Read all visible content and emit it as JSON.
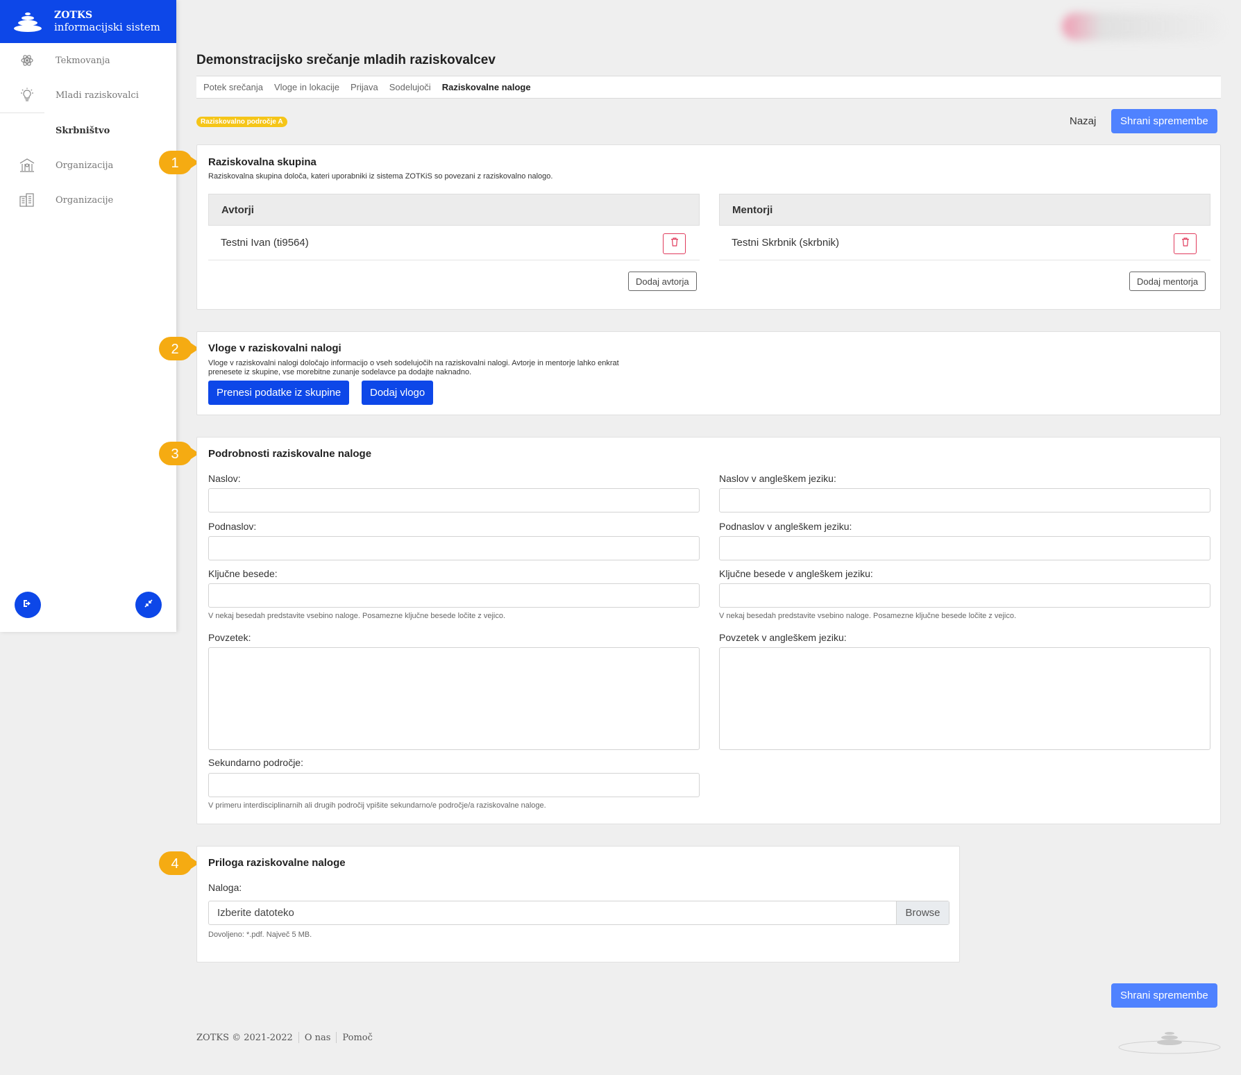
{
  "brand": {
    "line1": "ZOTKS",
    "line2": "informacijski sistem"
  },
  "sidebar": {
    "items": [
      {
        "label": "Tekmovanja",
        "icon": "atom-icon"
      },
      {
        "label": "Mladi raziskovalci",
        "icon": "lightbulb-icon"
      }
    ],
    "section": "Skrbništvo",
    "items2": [
      {
        "label": "Organizacija",
        "icon": "institution-icon"
      },
      {
        "label": "Organizacije",
        "icon": "buildings-icon"
      }
    ]
  },
  "page": {
    "title": "Demonstracijsko srečanje mladih raziskovalcev"
  },
  "tabs": [
    "Potek srečanja",
    "Vloge in lokacije",
    "Prijava",
    "Sodelujoči",
    "Raziskovalne naloge"
  ],
  "badge": "Raziskovalno področje A",
  "actions": {
    "back": "Nazaj",
    "save": "Shrani spremembe"
  },
  "markers": [
    "1",
    "2",
    "3",
    "4"
  ],
  "group": {
    "title": "Raziskovalna skupina",
    "desc": "Raziskovalna skupina določa, kateri uporabniki iz sistema ZOTKiS so povezani z raziskovalno nalogo.",
    "authors": {
      "header": "Avtorji",
      "rows": [
        "Testni Ivan (ti9564)"
      ],
      "add": "Dodaj avtorja"
    },
    "mentors": {
      "header": "Mentorji",
      "rows": [
        "Testni Skrbnik (skrbnik)"
      ],
      "add": "Dodaj mentorja"
    }
  },
  "roles": {
    "title": "Vloge v raziskovalni nalogi",
    "desc1": "Vloge v raziskovalni nalogi določajo informacijo o vseh sodelujočih na raziskovalni nalogi. Avtorje in mentorje lahko enkrat",
    "desc2": "prenesete iz skupine, vse morebitne zunanje sodelavce pa dodajte naknadno.",
    "transfer": "Prenesi podatke iz skupine",
    "add": "Dodaj vlogo"
  },
  "details": {
    "title": "Podrobnosti raziskovalne naloge",
    "naslov": "Naslov:",
    "naslov_en": "Naslov v angleškem jeziku:",
    "podnaslov": "Podnaslov:",
    "podnaslov_en": "Podnaslov v angleškem jeziku:",
    "kljucne": "Ključne besede:",
    "kljucne_en": "Ključne besede v angleškem jeziku:",
    "kljucne_hint": "V nekaj besedah predstavite vsebino naloge. Posamezne ključne besede ločite z vejico.",
    "povzetek": "Povzetek:",
    "povzetek_en": "Povzetek v angleškem jeziku:",
    "sekundarno": "Sekundarno področje:",
    "sekundarno_hint": "V primeru interdisciplinarnih ali drugih področij vpišite sekundarno/e področje/a raziskovalne naloge."
  },
  "attachment": {
    "title": "Priloga raziskovalne naloge",
    "label": "Naloga:",
    "placeholder": "Izberite datoteko",
    "browse": "Browse",
    "hint": "Dovoljeno: *.pdf. Največ 5 MB."
  },
  "footer": {
    "copy": "ZOTKS © 2021-2022",
    "about": "O nas",
    "help": "Pomoč"
  },
  "colors": {
    "brand": "#0d47e8",
    "accent": "#4f82ff",
    "marker": "#f5ab12",
    "badge": "#f5c518",
    "danger": "#e03b5c"
  }
}
